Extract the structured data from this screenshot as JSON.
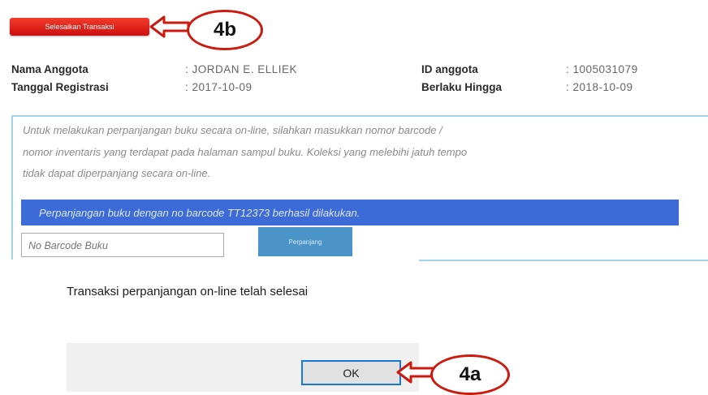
{
  "finish_button": {
    "label": "Selesaikan Transaksi"
  },
  "callouts": {
    "top": "4b",
    "bottom": "4a"
  },
  "member": {
    "name_label": "Nama Anggota",
    "name_value": ": JORDAN E. ELLIEK",
    "reg_label": "Tanggal Registrasi",
    "reg_value": ": 2017-10-09",
    "id_label": "ID anggota",
    "id_value": ": 1005031079",
    "valid_label": "Berlaku Hingga",
    "valid_value": ": 2018-10-09"
  },
  "renewal": {
    "instruction_line1": "Untuk melakukan perpanjangan buku secara on-line, silahkan masukkan nomor barcode /",
    "instruction_line2": "nomor inventaris yang terdapat pada halaman sampul buku. Koleksi yang melebihi jatuh tempo",
    "instruction_line3": "tidak dapat diperpanjang secara on-line.",
    "success_message": "Perpanjangan buku dengan no barcode TT12373 berhasil dilakukan.",
    "barcode_placeholder": "No Barcode Buku",
    "extend_button": "Perpanjang"
  },
  "dialog": {
    "message": "Transaksi perpanjangan on-line telah selesai",
    "ok_label": "OK"
  },
  "colors": {
    "accent_red": "#cc1a0e",
    "banner_blue": "#3c6ad6",
    "button_blue": "#4a94c8",
    "panel_border": "#9fd6ec"
  }
}
